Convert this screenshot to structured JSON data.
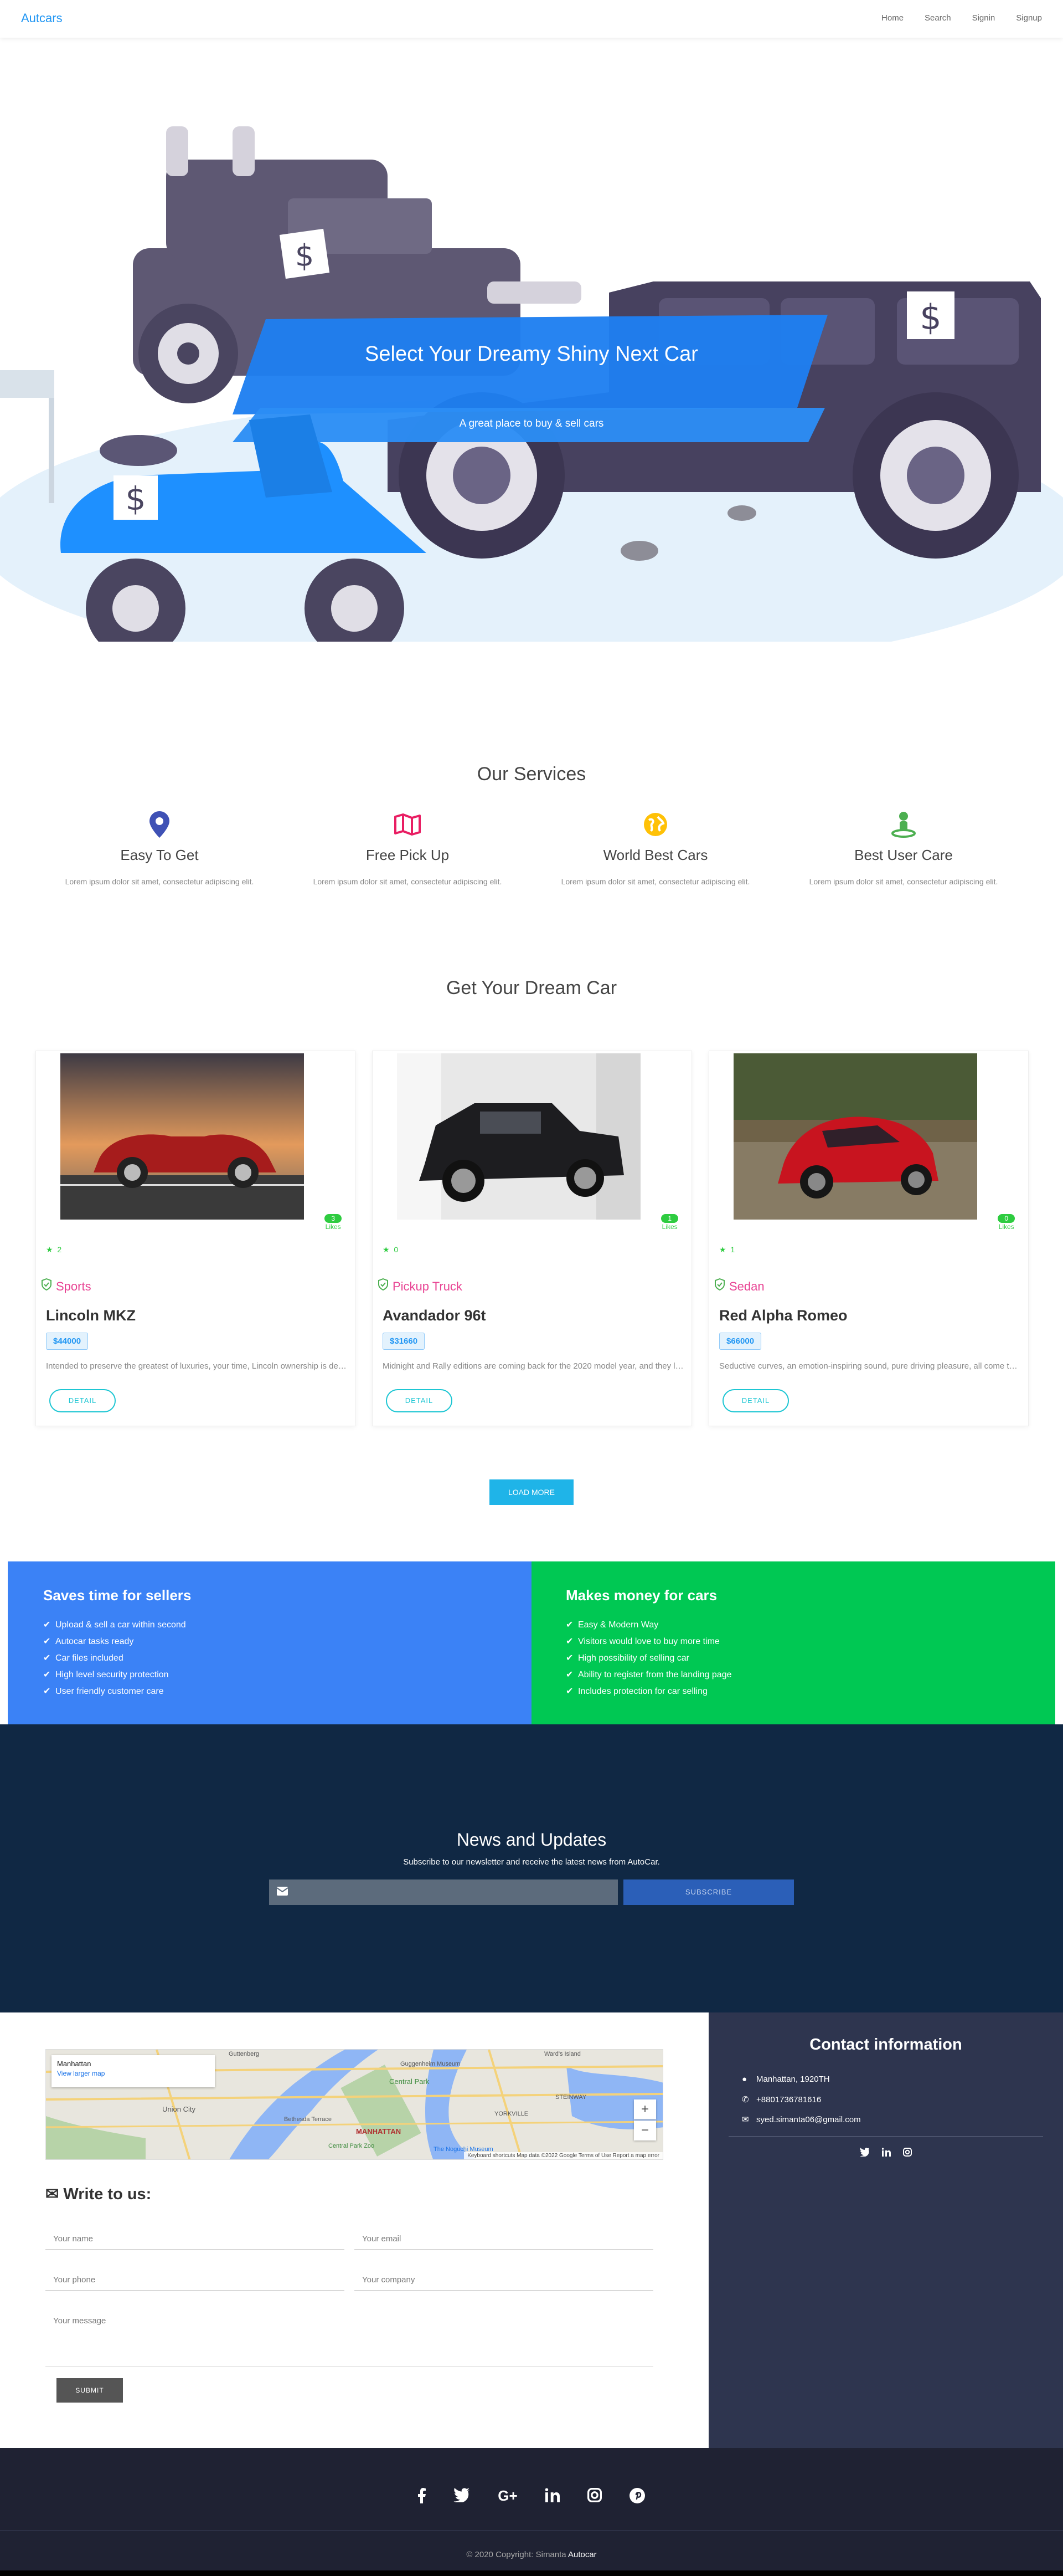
{
  "navbar": {
    "brand": "Autcars",
    "links": [
      "Home",
      "Search",
      "Signin",
      "Signup"
    ]
  },
  "hero": {
    "title": "Select Your Dreamy Shiny Next Car",
    "subtitle": "A great place to buy & sell cars",
    "price_tag_symbol": "$"
  },
  "services": {
    "title": "Our Services",
    "items": [
      {
        "title": "Easy To Get",
        "text": "Lorem ipsum dolor sit amet, consectetur adipiscing elit.",
        "icon": "map-pin-icon",
        "color": "#3f51b5"
      },
      {
        "title": "Free Pick Up",
        "text": "Lorem ipsum dolor sit amet, consectetur adipiscing elit.",
        "icon": "map-icon",
        "color": "#e91e63"
      },
      {
        "title": "World Best Cars",
        "text": "Lorem ipsum dolor sit amet, consectetur adipiscing elit.",
        "icon": "globe-icon",
        "color": "#ffc107"
      },
      {
        "title": "Best User Care",
        "text": "Lorem ipsum dolor sit amet, consectetur adipiscing elit.",
        "icon": "user-location-icon",
        "color": "#4caf50"
      }
    ]
  },
  "cars": {
    "title": "Get Your Dream Car",
    "likes_label": "Likes",
    "detail_label": "DETAIL",
    "items": [
      {
        "name": "Lincoln MKZ",
        "category": "Sports",
        "price": "$44000",
        "likes": "3",
        "rating": "2",
        "desc": "Intended to preserve the greatest of luxuries, your time, Lincoln ownership is designed to be effortless.",
        "photo": "red-classic-roadster"
      },
      {
        "name": "Avandador 96t",
        "category": "Pickup Truck",
        "price": "$31660",
        "likes": "1",
        "rating": "0",
        "desc": "Midnight and Rally editions are coming back for the 2020 model year, and they look great.",
        "photo": "black-pickup-truck"
      },
      {
        "name": "Red Alpha Romeo",
        "category": "Sedan",
        "price": "$66000",
        "likes": "0",
        "rating": "1",
        "desc": "Seductive curves, an emotion-inspiring sound, pure driving pleasure, all come together here.",
        "photo": "red-sports-car"
      }
    ],
    "load_more": "LOAD MORE"
  },
  "features": {
    "left": {
      "title": "Saves time for sellers",
      "items": [
        "Upload & sell a car within second",
        "Autocar tasks ready",
        "Car files included",
        "High level security protection",
        "User friendly customer care"
      ],
      "color": "#3b82f6"
    },
    "right": {
      "title": "Makes money for cars",
      "items": [
        "Easy & Modern Way",
        "Visitors would love to buy more time",
        "High possibility of selling car",
        "Ability to register from the landing page",
        "Includes protection for car selling"
      ],
      "color": "#00c853"
    }
  },
  "newsletter": {
    "title": "News and Updates",
    "text": "Subscribe to our newsletter and receive the latest news from AutoCar.",
    "input_placeholder": "",
    "button": "SUBSCRIBE"
  },
  "contact": {
    "map": {
      "card_title": "Manhattan",
      "card_link": "View larger map",
      "labels": [
        "Union City",
        "MANHATTAN",
        "Central Park",
        "Guggenheim Museum",
        "Bethesda Terrace",
        "YORKVILLE",
        "The Noguchi Museum",
        "Central Park Zoo",
        "Ward's Island",
        "STEINWAY",
        "Guttenberg"
      ],
      "zoom_in": "+",
      "zoom_out": "−",
      "footer": "Keyboard shortcuts   Map data ©2022 Google   Terms of Use   Report a map error"
    },
    "write_title": "Write to us:",
    "fields": {
      "name": "Your name",
      "email": "Your email",
      "phone": "Your phone",
      "company": "Your company",
      "message": "Your message"
    },
    "submit": "SUBMIT",
    "info": {
      "title": "Contact information",
      "address": "Manhattan, 1920TH",
      "phone": "+8801736781616",
      "email": "syed.simanta06@gmail.com"
    }
  },
  "footer": {
    "copyright_prefix": "© 2020 Copyright: Simanta",
    "copyright_brand": "Autocar",
    "social": [
      "facebook-icon",
      "twitter-icon",
      "google-plus-icon",
      "linkedin-icon",
      "instagram-icon",
      "pinterest-icon"
    ]
  }
}
